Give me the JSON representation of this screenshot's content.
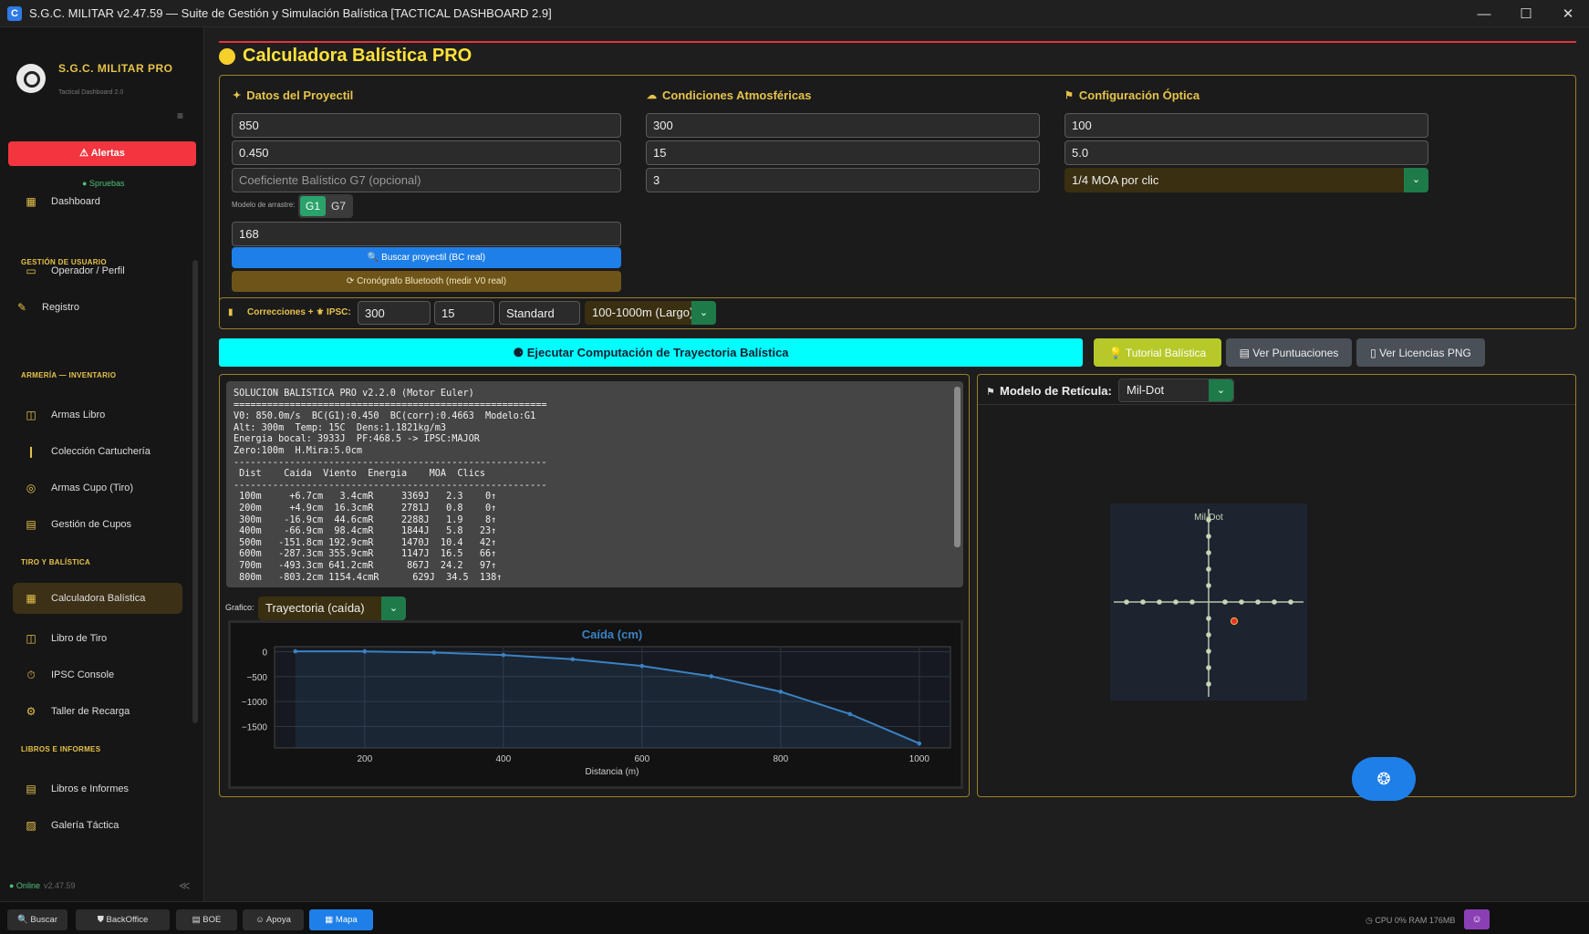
{
  "window": {
    "title": "S.G.C. MILITAR v2.47.59 — Suite de Gestión y Simulación Balística [TACTICAL DASHBOARD 2.9]",
    "app_icon": "C",
    "minimize": "—",
    "maximize": "☐",
    "close": "✕"
  },
  "sidebar": {
    "brand_name": "S.G.C. MILITAR PRO",
    "brand_sub": "Tactical Dashboard 2.0",
    "menu_icon": "≡",
    "alert_label": "⚠ Alertas",
    "status_label": "● Spruebas",
    "sections": {
      "usuario": "GESTIÓN DE USUARIO",
      "armeria": "ARMERÍA — INVENTARIO",
      "tiro": "TIRO Y BALÍSTICA",
      "libros": "LIBROS E INFORMES"
    },
    "items": [
      {
        "label": "Dashboard",
        "icon": "▦"
      },
      {
        "label": "Operador / Perfil",
        "icon": "▭"
      },
      {
        "label": "Registro",
        "icon": "✎"
      },
      {
        "label": "Armas Libro",
        "icon": "◫"
      },
      {
        "label": "Colección Cartuchería",
        "icon": "❙"
      },
      {
        "label": "Armas Cupo (Tiro)",
        "icon": "◎"
      },
      {
        "label": "Gestión de Cupos",
        "icon": "▤"
      },
      {
        "label": "Calculadora Balística",
        "icon": "▦"
      },
      {
        "label": "Libro de Tiro",
        "icon": "◫"
      },
      {
        "label": "IPSC Console",
        "icon": "⏱"
      },
      {
        "label": "Taller de Recarga",
        "icon": "⚙"
      },
      {
        "label": "Libros e Informes",
        "icon": "▤"
      },
      {
        "label": "Galería Táctica",
        "icon": "▨"
      }
    ],
    "online": "● Online",
    "version": "v2.47.59",
    "collapse": "≪"
  },
  "page": {
    "title": "Calculadora Balística PRO"
  },
  "proyectil": {
    "heading": "Datos del Proyectil",
    "v0": "850",
    "bc": "0.450",
    "bc_g7_placeholder": "Coeficiente Balístico G7 (opcional)",
    "drag_label": "Modelo de arrastre:",
    "drag_options": [
      "G1",
      "G7"
    ],
    "weight": "168",
    "search_button": "🔍 Buscar proyectil (BC real)",
    "chrono_button": "⟳ Cronógrafo Bluetooth (medir V0 real)"
  },
  "atmosfera": {
    "heading": "Condiciones Atmosféricas",
    "altitude": "300",
    "temperature": "15",
    "wind": "3"
  },
  "optica": {
    "heading": "Configuración Óptica",
    "zero": "100",
    "sight_height": "5.0",
    "click_value": "1/4 MOA por clic"
  },
  "correcciones": {
    "label": "Correcciones + ⚜ IPSC:",
    "field1": "300",
    "field2": "15",
    "field3": "Standard",
    "range": "100-1000m (Largo)"
  },
  "toolbar": {
    "run": "⚈ Ejecutar Computación de Trayectoria Balística",
    "tutorial": "💡 Tutorial Balística",
    "scores": "▤ Ver Puntuaciones",
    "licenses": "▯ Ver Licencias PNG"
  },
  "console": {
    "text": "SOLUCION BALISTICA PRO v2.2.0 (Motor Euler)\n========================================================\nV0: 850.0m/s  BC(G1):0.450  BC(corr):0.4663  Modelo:G1\nAlt: 300m  Temp: 15C  Dens:1.1821kg/m3\nEnergia bocal: 3933J  PF:468.5 -> IPSC:MAJOR\nZero:100m  H.Mira:5.0cm\n--------------------------------------------------------\n Dist    Caida  Viento  Energia    MOA  Clics\n--------------------------------------------------------\n 100m     +6.7cm   3.4cmR     3369J   2.3    0↑\n 200m     +4.9cm  16.3cmR     2781J   0.8    0↑\n 300m    -16.9cm  44.6cmR     2288J   1.9    8↑\n 400m    -66.9cm  98.4cmR     1844J   5.8   23↑\n 500m   -151.8cm 192.9cmR     1470J  10.4   42↑\n 600m   -287.3cm 355.9cmR     1147J  16.5   66↑\n 700m   -493.3cm 641.2cmR      867J  24.2   97↑\n 800m   -803.2cm 1154.4cmR      629J  34.5  138↑"
  },
  "grafico": {
    "label": "Grafico:",
    "selected": "Trayectoria (caída)"
  },
  "chart_data": {
    "type": "line",
    "title": "Caída (cm)",
    "xlabel": "Distancia (m)",
    "ylabel": "",
    "x": [
      100,
      200,
      300,
      400,
      500,
      600,
      700,
      800,
      900,
      1000
    ],
    "values": [
      6.7,
      4.9,
      -16.9,
      -66.9,
      -151.8,
      -287.3,
      -493.3,
      -803.2,
      -1250,
      -1840
    ],
    "xlim": [
      70,
      1045
    ],
    "ylim": [
      -1930,
      100
    ],
    "xticks": [
      200,
      400,
      600,
      800,
      1000
    ],
    "yticks": [
      0,
      -500,
      -1000,
      -1500
    ],
    "grid": true,
    "color": "#3b82c4"
  },
  "reticula": {
    "label": "Modelo de Retícula:",
    "selected": "Mil-Dot",
    "chart_label": "Mil-Dot",
    "impact_color": "#e8322c"
  },
  "taskbar": {
    "buscar": "🔍 Buscar",
    "backoffice": "⛊ BackOffice",
    "boe": "▤ BOE",
    "apoya": "☺ Apoya",
    "mapa": "▦ Mapa",
    "sysinfo": "◷ CPU 0%   RAM 176MB",
    "sysbtn": "☺"
  }
}
